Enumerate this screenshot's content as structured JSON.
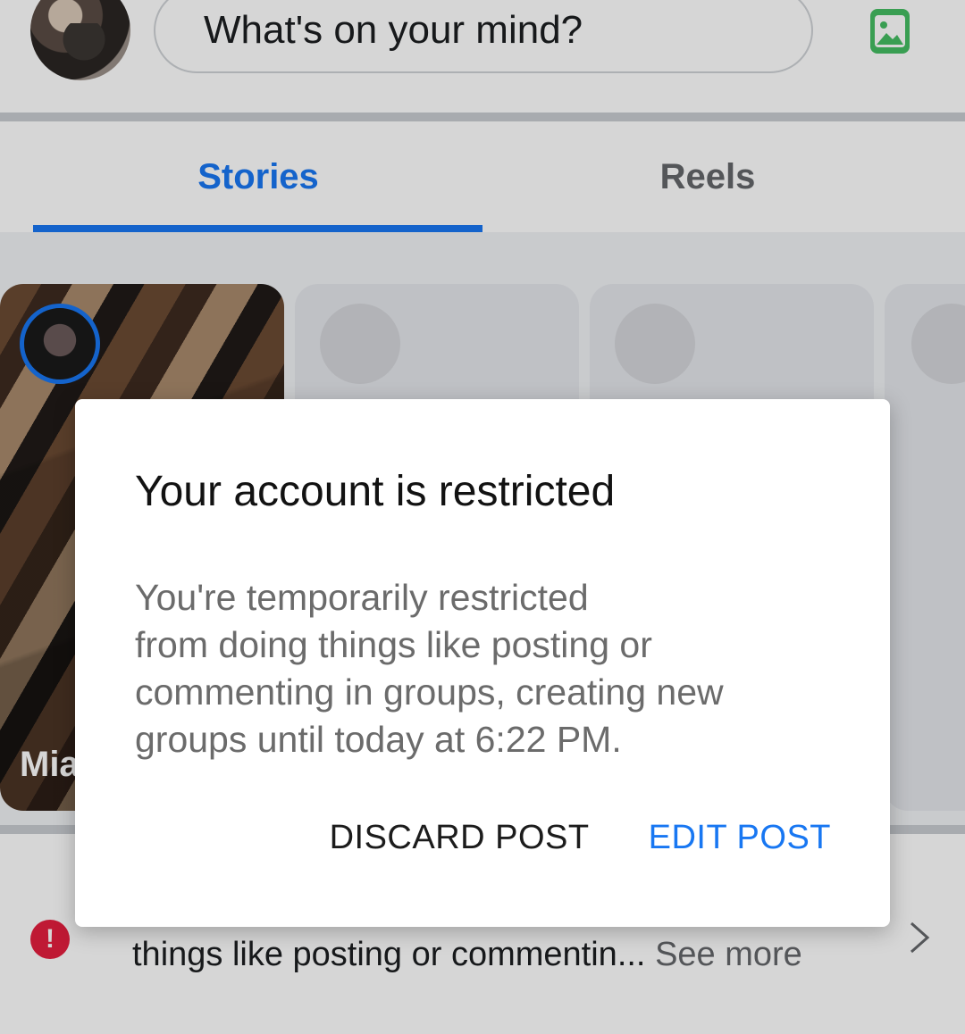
{
  "composer": {
    "placeholder": "What's on your mind?",
    "avatar_icon": "profile-photo",
    "photo_icon": "photo-icon"
  },
  "tabs": [
    {
      "label": "Stories",
      "active": true
    },
    {
      "label": "Reels",
      "active": false
    }
  ],
  "stories": {
    "first_name": "Mia"
  },
  "notice": {
    "alert_icon": "!",
    "text": "things like posting or commentin... ",
    "see_more": "See more"
  },
  "dialog": {
    "title": "Your account is restricted",
    "body_lines": [
      "You're temporarily restricted",
      "from doing things like posting or",
      "commenting in groups, creating new",
      "groups until today at 6:22 PM."
    ],
    "discard_label": "DISCARD POST",
    "edit_label": "EDIT POST"
  },
  "colors": {
    "accent": "#1877f2",
    "alert": "#e41e3f",
    "photo_green": "#45bd62"
  }
}
